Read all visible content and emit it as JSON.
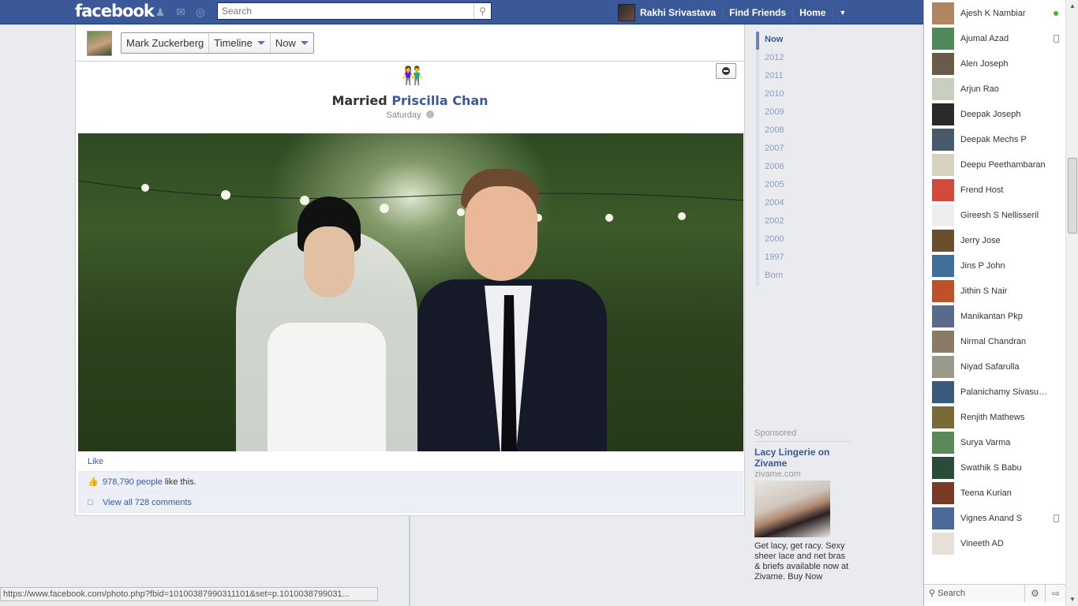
{
  "topbar": {
    "logo": "facebook",
    "search_placeholder": "Search",
    "user_name": "Rakhi Srivastava",
    "find_friends": "Find Friends",
    "home": "Home"
  },
  "header": {
    "profile_name": "Mark Zuckerberg",
    "timeline_label": "Timeline",
    "now_label": "Now"
  },
  "story": {
    "title_prefix": "Married",
    "title_link": "Priscilla Chan",
    "date": "Saturday",
    "like": "Like",
    "likes_count": "978,790 people",
    "likes_suffix": " like this.",
    "comments": "View all 728 comments"
  },
  "scrubber": [
    "Now",
    "2012",
    "2011",
    "2010",
    "2009",
    "2008",
    "2007",
    "2006",
    "2005",
    "2004",
    "2002",
    "2000",
    "1997",
    "Born"
  ],
  "sponsored": {
    "heading": "Sponsored",
    "title": "Lacy Lingerie on Zivame",
    "domain": "zivame.com",
    "body": "Get lacy, get racy. Sexy sheer lace and net bras & briefs available now at Zivame. Buy Now"
  },
  "statusbar": "https://www.facebook.com/photo.php?fbid=10100387990311101&set=p.1010038799031...",
  "chat": {
    "friends": [
      {
        "name": "Ajesh K Nambiar",
        "status": "online",
        "color": "#b08660"
      },
      {
        "name": "Ajumal Azad",
        "status": "mobile",
        "color": "#4f8a5a"
      },
      {
        "name": "Alen Joseph",
        "status": "",
        "color": "#6a5a4a"
      },
      {
        "name": "Arjun Rao",
        "status": "",
        "color": "#c9cfc0"
      },
      {
        "name": "Deepak Joseph",
        "status": "",
        "color": "#2a2a2a"
      },
      {
        "name": "Deepak Mechs P",
        "status": "",
        "color": "#4b5a6b"
      },
      {
        "name": "Deepu Peethambaran",
        "status": "",
        "color": "#d8d2c0"
      },
      {
        "name": "Frend Host",
        "status": "",
        "color": "#d24a3a"
      },
      {
        "name": "Gireesh S Nellisseril",
        "status": "",
        "color": "#eeeeee"
      },
      {
        "name": "Jerry Jose",
        "status": "",
        "color": "#6b4e2e"
      },
      {
        "name": "Jins P John",
        "status": "",
        "color": "#3f6f9a"
      },
      {
        "name": "Jithin S Nair",
        "status": "",
        "color": "#c0502a"
      },
      {
        "name": "Manikantan Pkp",
        "status": "",
        "color": "#5a6a8a"
      },
      {
        "name": "Nirmal Chandran",
        "status": "",
        "color": "#8a7a6a"
      },
      {
        "name": "Niyad Safarulla",
        "status": "",
        "color": "#9a9a8a"
      },
      {
        "name": "Palanichamy Sivasub...",
        "status": "",
        "color": "#3a5a7a"
      },
      {
        "name": "Renjith Mathews",
        "status": "",
        "color": "#7a6a3a"
      },
      {
        "name": "Surya Varma",
        "status": "",
        "color": "#5a8a5a"
      },
      {
        "name": "Swathik S Babu",
        "status": "",
        "color": "#2a4a3a"
      },
      {
        "name": "Teena Kurian",
        "status": "",
        "color": "#7a3a2a"
      },
      {
        "name": "Vignes Anand S",
        "status": "mobile",
        "color": "#4a6a9a"
      },
      {
        "name": "Vineeth AD",
        "status": "",
        "color": "#e6e0d8"
      }
    ],
    "search": "Search"
  }
}
